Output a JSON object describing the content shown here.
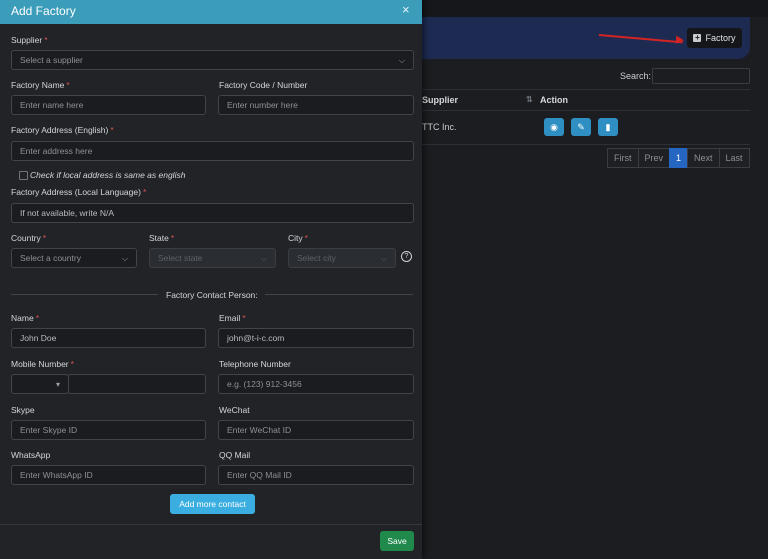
{
  "background": {
    "factory_button": "Factory",
    "search_label": "Search:",
    "table": {
      "headers": [
        "Supplier",
        "Action"
      ],
      "row_supplier": "TTC Inc."
    },
    "pagination": [
      "First",
      "Prev",
      "1",
      "Next",
      "Last"
    ],
    "colors": {
      "arrow": "#d32424",
      "banner": "#1d2b52"
    }
  },
  "modal": {
    "title": "Add Factory",
    "close_icon": "×",
    "supplier": {
      "label": "Supplier",
      "placeholder": "Select a supplier"
    },
    "factory_name": {
      "label": "Factory Name",
      "placeholder": "Enter name here"
    },
    "factory_code": {
      "label": "Factory Code / Number",
      "placeholder": "Enter number here"
    },
    "address_en": {
      "label": "Factory Address (English)",
      "placeholder": "Enter address here"
    },
    "same_as_english": "Check if local address is same as english",
    "address_local": {
      "label": "Factory Address (Local Language)",
      "placeholder": "If not available, write N/A"
    },
    "country": {
      "label": "Country",
      "placeholder": "Select a country"
    },
    "state": {
      "label": "State",
      "placeholder": "Select state"
    },
    "city": {
      "label": "City",
      "placeholder": "Select city"
    },
    "contact_section": "Factory Contact Person:",
    "name": {
      "label": "Name",
      "value": "John Doe"
    },
    "email": {
      "label": "Email",
      "value": "john@t-i-c.com"
    },
    "mobile": {
      "label": "Mobile Number",
      "value": ""
    },
    "telephone": {
      "label": "Telephone Number",
      "placeholder": "e.g. (123) 912-3456"
    },
    "skype": {
      "label": "Skype",
      "placeholder": "Enter Skype ID"
    },
    "wechat": {
      "label": "WeChat",
      "placeholder": "Enter WeChat ID"
    },
    "whatsapp": {
      "label": "WhatsApp",
      "placeholder": "Enter WhatsApp ID"
    },
    "qqmail": {
      "label": "QQ Mail",
      "placeholder": "Enter QQ Mail ID"
    },
    "add_more_contact": "Add more contact",
    "save": "Save",
    "colors": {
      "header": "#3b9dba",
      "save": "#1f8a4c",
      "add_more": "#3aaee0",
      "required": "#d9534f"
    }
  }
}
